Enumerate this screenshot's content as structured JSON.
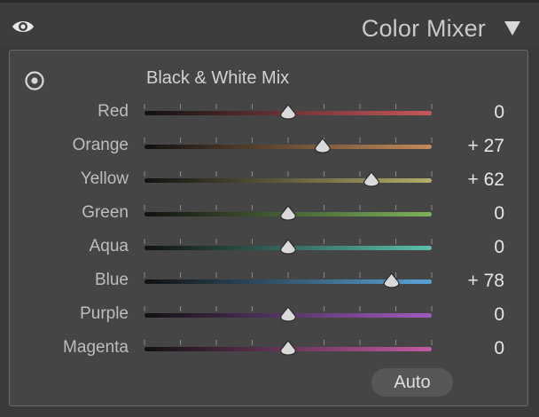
{
  "header": {
    "title": "Color Mixer"
  },
  "icons": {
    "eye": "eye-icon",
    "collapse": "triangle-down-icon",
    "target": "target-adjust-icon"
  },
  "panel": {
    "title": "Black & White Mix",
    "auto_label": "Auto"
  },
  "sliders": [
    {
      "label": "Red",
      "value": "0",
      "fraction": 0.5,
      "color": "#c8575a"
    },
    {
      "label": "Orange",
      "value": "+ 27",
      "fraction": 0.62,
      "color": "#c38a5a"
    },
    {
      "label": "Yellow",
      "value": "+ 62",
      "fraction": 0.79,
      "color": "#b3ad6a"
    },
    {
      "label": "Green",
      "value": "0",
      "fraction": 0.5,
      "color": "#7db35a"
    },
    {
      "label": "Aqua",
      "value": "0",
      "fraction": 0.5,
      "color": "#5cc0ac"
    },
    {
      "label": "Blue",
      "value": "+ 78",
      "fraction": 0.86,
      "color": "#5aa3d6"
    },
    {
      "label": "Purple",
      "value": "0",
      "fraction": 0.5,
      "color": "#a25ac0"
    },
    {
      "label": "Magenta",
      "value": "0",
      "fraction": 0.5,
      "color": "#c45aa3"
    }
  ]
}
